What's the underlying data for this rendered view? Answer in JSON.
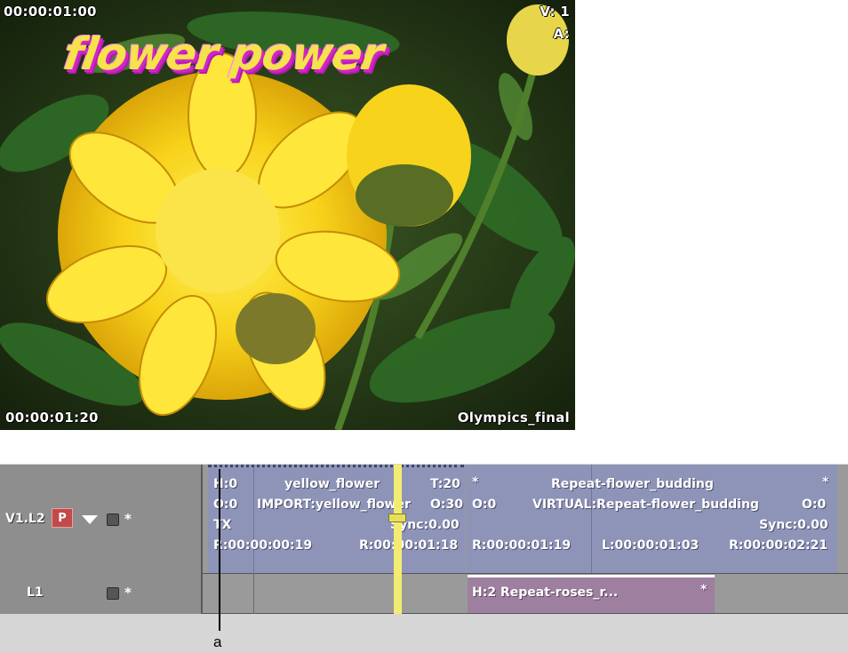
{
  "viewer": {
    "timecode_top": "00:00:01:00",
    "timecode_bottom": "00:00:01:20",
    "track_video": "V: 1",
    "track_audio": "A:",
    "clip_name": "Olympics_final",
    "title_text": "flower power"
  },
  "timeline": {
    "tracks": [
      {
        "label": "V1.L2",
        "primary_button": "P",
        "star": "*"
      },
      {
        "label": "L1",
        "star": "*"
      }
    ],
    "clips": {
      "yellow_flower": {
        "handle": "H:0",
        "name": "yellow_flower",
        "transition": "T:20",
        "offset": "O:0",
        "source": "IMPORT:yellow_flower",
        "offset_right": "O:30",
        "tx": "TX",
        "sync": "Sync:0.00",
        "range_in": "R:00:00:00:19",
        "range_out": "R:00:00:01:18"
      },
      "flower_budding": {
        "star_left": "*",
        "name": "Repeat-flower_budding",
        "star_right": "*",
        "offset": "O:0",
        "source": "VIRTUAL:Repeat-flower_budding",
        "offset_right": "O:0",
        "sync": "Sync:0.00",
        "range_in": "R:00:00:01:19",
        "length": "L:00:00:01:03",
        "range_out": "R:00:00:02:21"
      },
      "roses": {
        "label": "H:2 Repeat-roses_r...",
        "star": "*"
      }
    },
    "marker_label": "a"
  }
}
